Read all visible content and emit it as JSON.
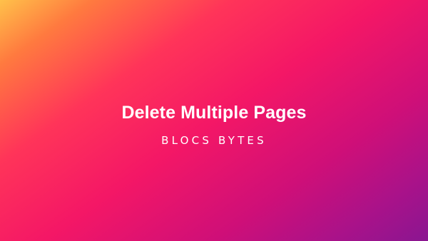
{
  "hero": {
    "title": "Delete Multiple Pages",
    "brand": "BLOCS BYTES"
  },
  "colors": {
    "text": "#ffffff",
    "gradient_start": "#ffc14a",
    "gradient_mid": "#f41766",
    "gradient_end": "#8a1691"
  }
}
